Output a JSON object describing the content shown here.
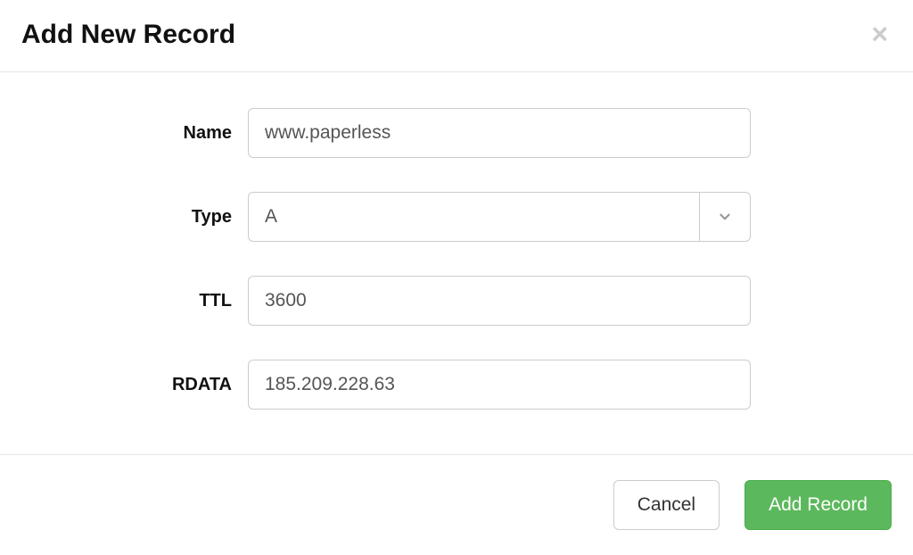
{
  "modal": {
    "title": "Add New Record"
  },
  "form": {
    "name": {
      "label": "Name",
      "value": "www.paperless"
    },
    "type": {
      "label": "Type",
      "value": "A"
    },
    "ttl": {
      "label": "TTL",
      "value": "3600"
    },
    "rdata": {
      "label": "RDATA",
      "value": "185.209.228.63"
    }
  },
  "footer": {
    "cancel": "Cancel",
    "submit": "Add Record"
  },
  "colors": {
    "submit_bg": "#5cb85c",
    "border": "#cccccc"
  }
}
